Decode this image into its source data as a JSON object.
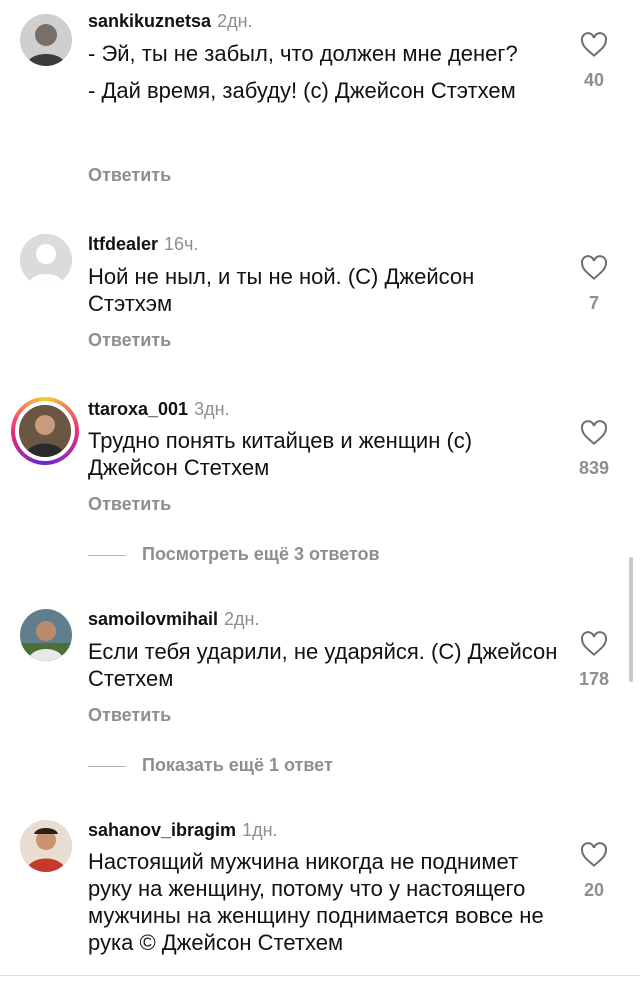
{
  "comments": [
    {
      "username": "sankikuznetsa",
      "time": "2дн.",
      "lines": [
        "- Эй, ты не забыл, что должен мне денег?",
        "- Дай время, забуду! (с) Джейсон Стэтхем"
      ],
      "reply": "Ответить",
      "likes": "40",
      "avatar_icon": "profile-photo"
    },
    {
      "username": "ltfdealer",
      "time": "16ч.",
      "lines": [
        "Ной не ныл, и ты не ной. (С) Джейсон Стэтхэм"
      ],
      "reply": "Ответить",
      "likes": "7",
      "avatar_icon": "default-avatar"
    },
    {
      "username": "ttaroxa_001",
      "time": "3дн.",
      "lines": [
        "Трудно понять китайцев и женщин (с) Джейсон Стетхем"
      ],
      "reply": "Ответить",
      "likes": "839",
      "avatar_icon": "profile-photo-story"
    },
    {
      "username": "samoilovmihail",
      "time": "2дн.",
      "lines": [
        "Если тебя ударили, не ударяйся. (С) Джейсон Стетхем"
      ],
      "reply": "Ответить",
      "likes": "178",
      "avatar_icon": "profile-photo"
    },
    {
      "username": "sahanov_ibragim",
      "time": "1дн.",
      "lines": [
        "Настоящий мужчина никогда не поднимет руку на женщину, потому что у настоящего мужчины на женщину поднимается вовсе не рука © Джейсон Стетхем"
      ],
      "likes": "20",
      "avatar_icon": "profile-photo"
    }
  ],
  "threads": [
    {
      "label": "Посмотреть ещё 3 ответов"
    },
    {
      "label": "Показать ещё 1 ответ"
    }
  ],
  "icons": {
    "like": "heart-outline-icon"
  },
  "colors": {
    "secondary_text": "#8e8e8e",
    "primary_text": "#111111"
  }
}
